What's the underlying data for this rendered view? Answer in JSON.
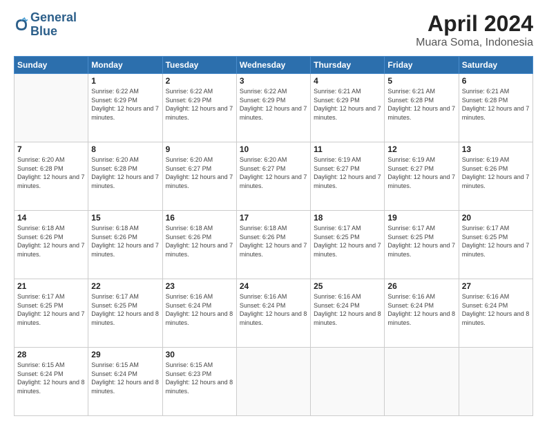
{
  "logo": {
    "line1": "General",
    "line2": "Blue"
  },
  "title": "April 2024",
  "subtitle": "Muara Soma, Indonesia",
  "days_header": [
    "Sunday",
    "Monday",
    "Tuesday",
    "Wednesday",
    "Thursday",
    "Friday",
    "Saturday"
  ],
  "weeks": [
    [
      {
        "day": "",
        "sunrise": "",
        "sunset": "",
        "daylight": ""
      },
      {
        "day": "1",
        "sunrise": "Sunrise: 6:22 AM",
        "sunset": "Sunset: 6:29 PM",
        "daylight": "Daylight: 12 hours and 7 minutes."
      },
      {
        "day": "2",
        "sunrise": "Sunrise: 6:22 AM",
        "sunset": "Sunset: 6:29 PM",
        "daylight": "Daylight: 12 hours and 7 minutes."
      },
      {
        "day": "3",
        "sunrise": "Sunrise: 6:22 AM",
        "sunset": "Sunset: 6:29 PM",
        "daylight": "Daylight: 12 hours and 7 minutes."
      },
      {
        "day": "4",
        "sunrise": "Sunrise: 6:21 AM",
        "sunset": "Sunset: 6:29 PM",
        "daylight": "Daylight: 12 hours and 7 minutes."
      },
      {
        "day": "5",
        "sunrise": "Sunrise: 6:21 AM",
        "sunset": "Sunset: 6:28 PM",
        "daylight": "Daylight: 12 hours and 7 minutes."
      },
      {
        "day": "6",
        "sunrise": "Sunrise: 6:21 AM",
        "sunset": "Sunset: 6:28 PM",
        "daylight": "Daylight: 12 hours and 7 minutes."
      }
    ],
    [
      {
        "day": "7",
        "sunrise": "Sunrise: 6:20 AM",
        "sunset": "Sunset: 6:28 PM",
        "daylight": "Daylight: 12 hours and 7 minutes."
      },
      {
        "day": "8",
        "sunrise": "Sunrise: 6:20 AM",
        "sunset": "Sunset: 6:28 PM",
        "daylight": "Daylight: 12 hours and 7 minutes."
      },
      {
        "day": "9",
        "sunrise": "Sunrise: 6:20 AM",
        "sunset": "Sunset: 6:27 PM",
        "daylight": "Daylight: 12 hours and 7 minutes."
      },
      {
        "day": "10",
        "sunrise": "Sunrise: 6:20 AM",
        "sunset": "Sunset: 6:27 PM",
        "daylight": "Daylight: 12 hours and 7 minutes."
      },
      {
        "day": "11",
        "sunrise": "Sunrise: 6:19 AM",
        "sunset": "Sunset: 6:27 PM",
        "daylight": "Daylight: 12 hours and 7 minutes."
      },
      {
        "day": "12",
        "sunrise": "Sunrise: 6:19 AM",
        "sunset": "Sunset: 6:27 PM",
        "daylight": "Daylight: 12 hours and 7 minutes."
      },
      {
        "day": "13",
        "sunrise": "Sunrise: 6:19 AM",
        "sunset": "Sunset: 6:26 PM",
        "daylight": "Daylight: 12 hours and 7 minutes."
      }
    ],
    [
      {
        "day": "14",
        "sunrise": "Sunrise: 6:18 AM",
        "sunset": "Sunset: 6:26 PM",
        "daylight": "Daylight: 12 hours and 7 minutes."
      },
      {
        "day": "15",
        "sunrise": "Sunrise: 6:18 AM",
        "sunset": "Sunset: 6:26 PM",
        "daylight": "Daylight: 12 hours and 7 minutes."
      },
      {
        "day": "16",
        "sunrise": "Sunrise: 6:18 AM",
        "sunset": "Sunset: 6:26 PM",
        "daylight": "Daylight: 12 hours and 7 minutes."
      },
      {
        "day": "17",
        "sunrise": "Sunrise: 6:18 AM",
        "sunset": "Sunset: 6:26 PM",
        "daylight": "Daylight: 12 hours and 7 minutes."
      },
      {
        "day": "18",
        "sunrise": "Sunrise: 6:17 AM",
        "sunset": "Sunset: 6:25 PM",
        "daylight": "Daylight: 12 hours and 7 minutes."
      },
      {
        "day": "19",
        "sunrise": "Sunrise: 6:17 AM",
        "sunset": "Sunset: 6:25 PM",
        "daylight": "Daylight: 12 hours and 7 minutes."
      },
      {
        "day": "20",
        "sunrise": "Sunrise: 6:17 AM",
        "sunset": "Sunset: 6:25 PM",
        "daylight": "Daylight: 12 hours and 7 minutes."
      }
    ],
    [
      {
        "day": "21",
        "sunrise": "Sunrise: 6:17 AM",
        "sunset": "Sunset: 6:25 PM",
        "daylight": "Daylight: 12 hours and 7 minutes."
      },
      {
        "day": "22",
        "sunrise": "Sunrise: 6:17 AM",
        "sunset": "Sunset: 6:25 PM",
        "daylight": "Daylight: 12 hours and 8 minutes."
      },
      {
        "day": "23",
        "sunrise": "Sunrise: 6:16 AM",
        "sunset": "Sunset: 6:24 PM",
        "daylight": "Daylight: 12 hours and 8 minutes."
      },
      {
        "day": "24",
        "sunrise": "Sunrise: 6:16 AM",
        "sunset": "Sunset: 6:24 PM",
        "daylight": "Daylight: 12 hours and 8 minutes."
      },
      {
        "day": "25",
        "sunrise": "Sunrise: 6:16 AM",
        "sunset": "Sunset: 6:24 PM",
        "daylight": "Daylight: 12 hours and 8 minutes."
      },
      {
        "day": "26",
        "sunrise": "Sunrise: 6:16 AM",
        "sunset": "Sunset: 6:24 PM",
        "daylight": "Daylight: 12 hours and 8 minutes."
      },
      {
        "day": "27",
        "sunrise": "Sunrise: 6:16 AM",
        "sunset": "Sunset: 6:24 PM",
        "daylight": "Daylight: 12 hours and 8 minutes."
      }
    ],
    [
      {
        "day": "28",
        "sunrise": "Sunrise: 6:15 AM",
        "sunset": "Sunset: 6:24 PM",
        "daylight": "Daylight: 12 hours and 8 minutes."
      },
      {
        "day": "29",
        "sunrise": "Sunrise: 6:15 AM",
        "sunset": "Sunset: 6:24 PM",
        "daylight": "Daylight: 12 hours and 8 minutes."
      },
      {
        "day": "30",
        "sunrise": "Sunrise: 6:15 AM",
        "sunset": "Sunset: 6:23 PM",
        "daylight": "Daylight: 12 hours and 8 minutes."
      },
      {
        "day": "",
        "sunrise": "",
        "sunset": "",
        "daylight": ""
      },
      {
        "day": "",
        "sunrise": "",
        "sunset": "",
        "daylight": ""
      },
      {
        "day": "",
        "sunrise": "",
        "sunset": "",
        "daylight": ""
      },
      {
        "day": "",
        "sunrise": "",
        "sunset": "",
        "daylight": ""
      }
    ]
  ]
}
